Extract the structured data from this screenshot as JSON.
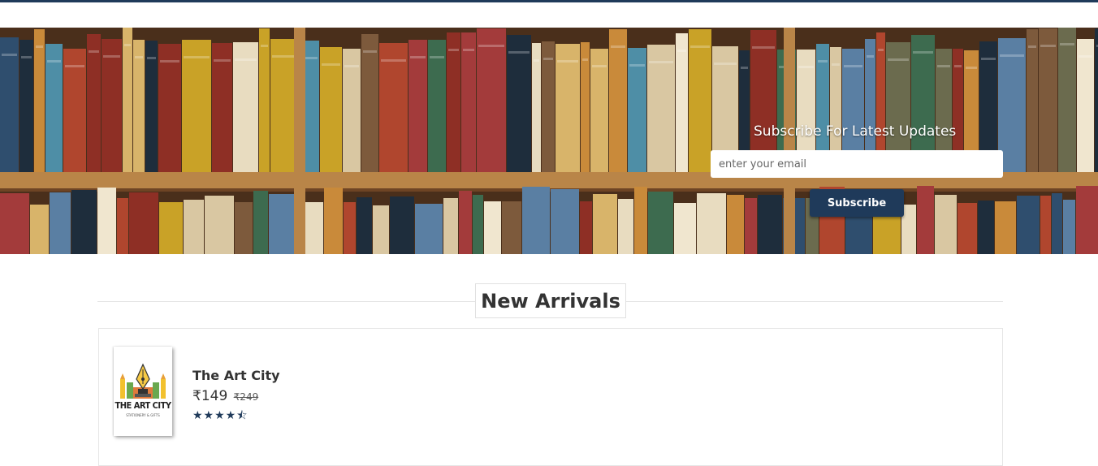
{
  "banner": {
    "subscribe_title": "Subscribe For Latest Updates",
    "email_placeholder": "enter your email",
    "subscribe_button": "Subscribe"
  },
  "new_arrivals": {
    "title": "New Arrivals",
    "products": [
      {
        "name": "The Art City",
        "price": "₹149",
        "old_price": "₹249",
        "rating": 4.5,
        "rating_stars": "★★★★⯪",
        "cover_title": "THE ART CITY",
        "cover_subtitle": "STATIONERY & GIFTS"
      }
    ]
  },
  "colors": {
    "accent": "#1f3a5a",
    "banner_wood": "#5a3b22"
  },
  "icons": [
    "star-icon",
    "half-star-icon",
    "pen-nib-logo-icon"
  ]
}
